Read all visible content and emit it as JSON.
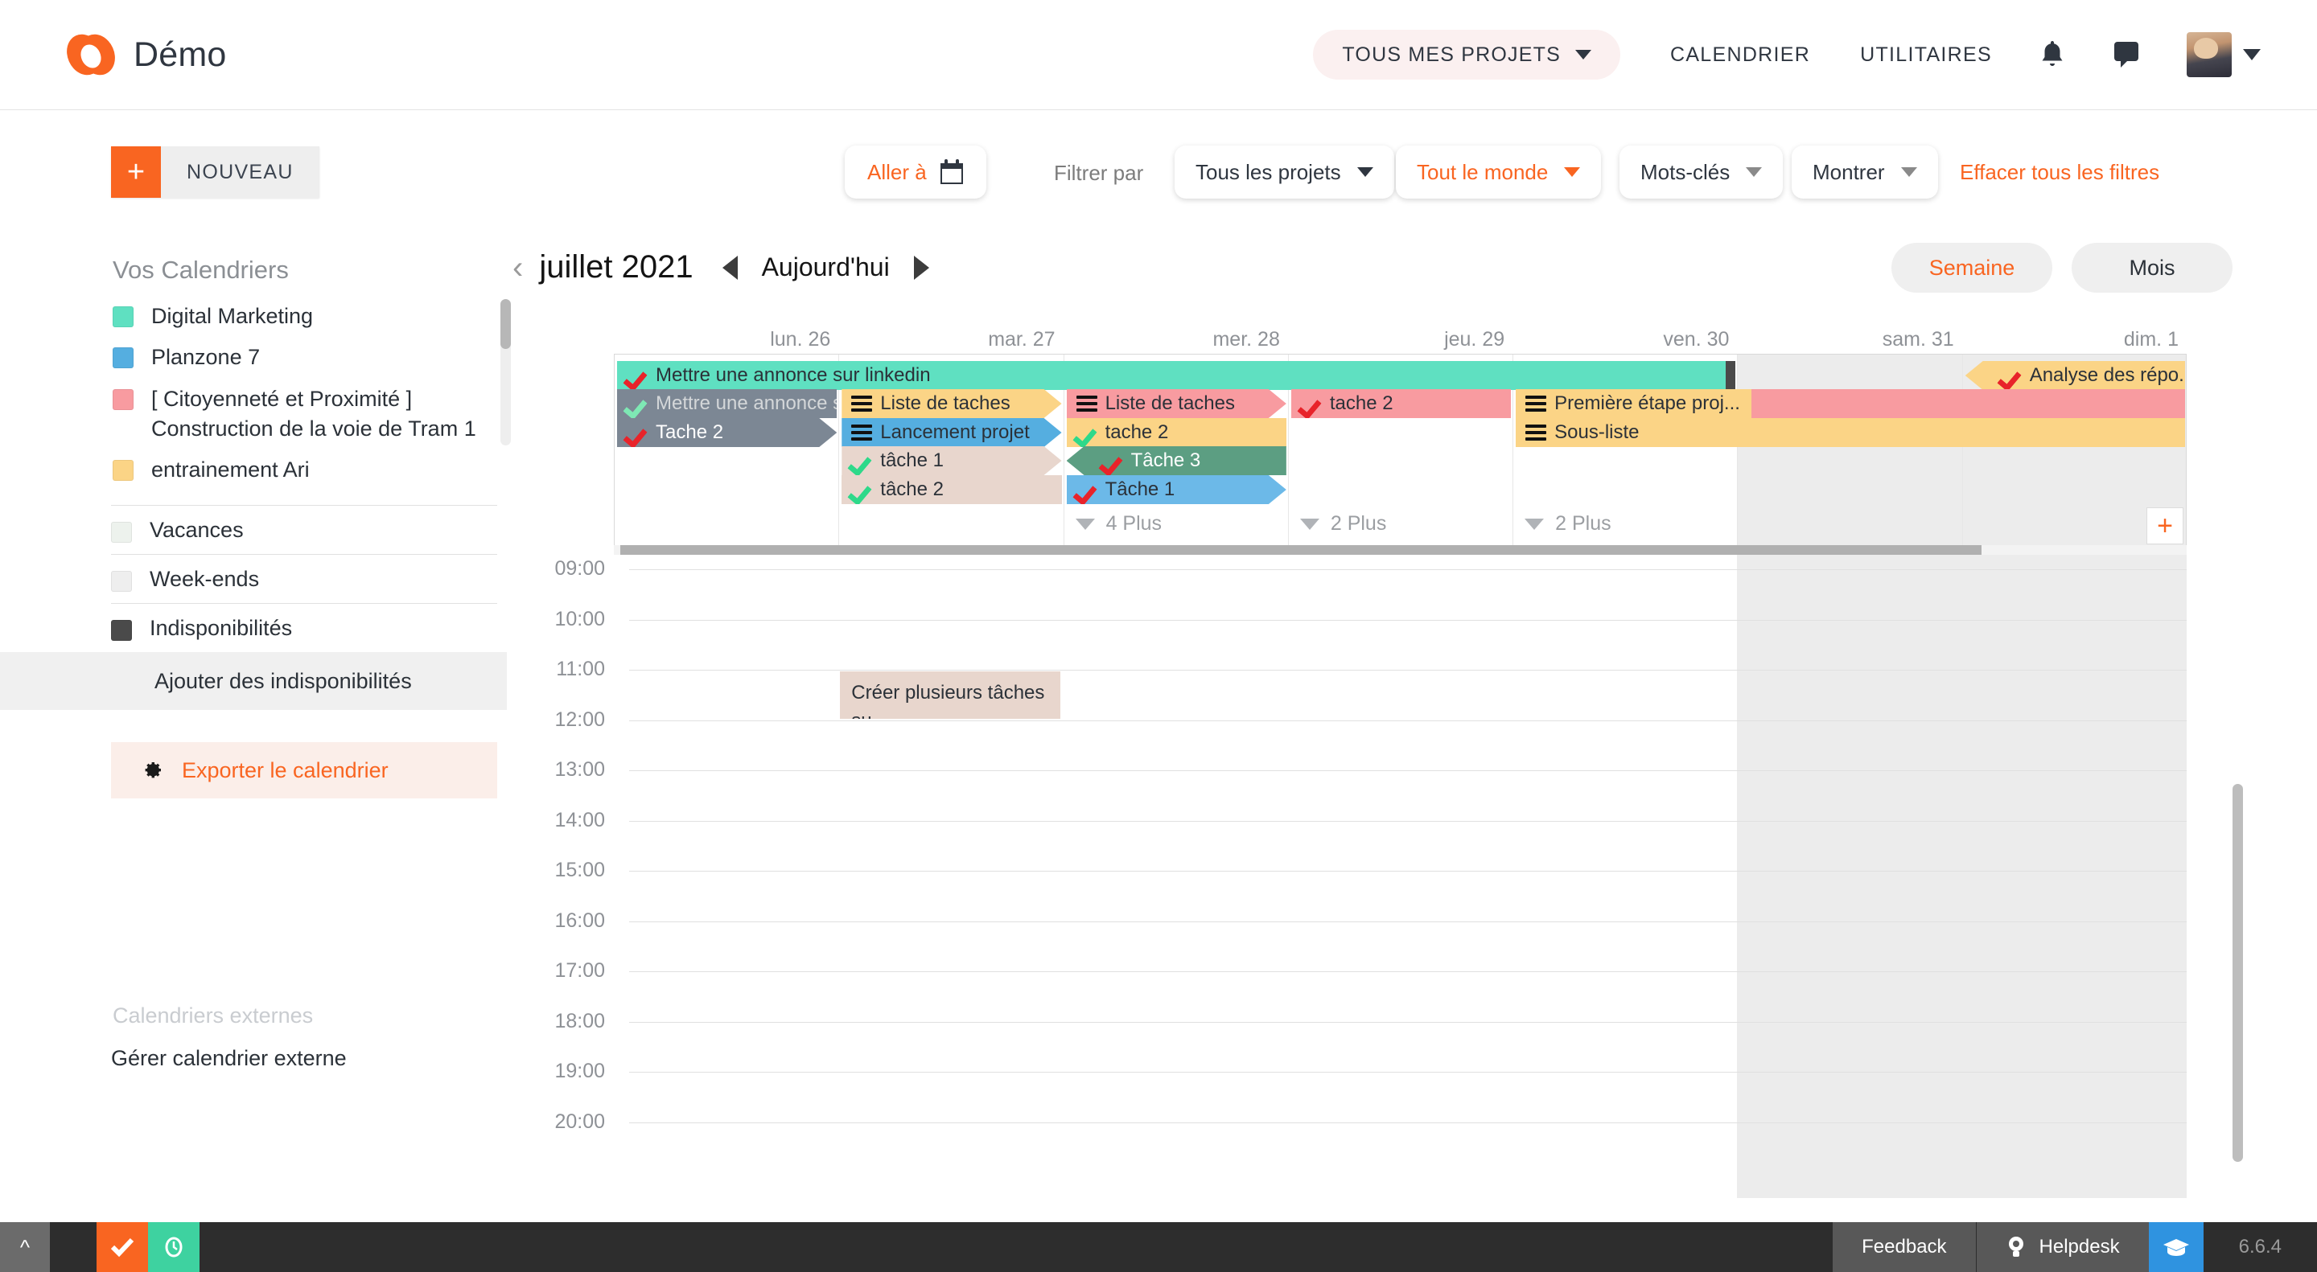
{
  "app": {
    "brand_name": "Démo",
    "logo_color": "#f96521"
  },
  "topnav": {
    "projects_selector": "TOUS MES PROJETS",
    "links": [
      "CALENDRIER",
      "UTILITAIRES"
    ],
    "bell_icon": "bell-icon",
    "chat_icon": "chat-bubble-icon",
    "avatar": "user-avatar"
  },
  "filterbar": {
    "new_button": "NOUVEAU",
    "new_plus": "+",
    "goto": "Aller à",
    "goto_icon": "calendar-icon",
    "filter_label": "Filtrer par",
    "dropdowns": [
      {
        "label": "Tous les projets",
        "accent": "#2f3640"
      },
      {
        "label": "Tout le monde",
        "accent": "#f96521"
      },
      {
        "label": "Mots-clés",
        "accent": "#2f3640"
      },
      {
        "label": "Montrer",
        "accent": "#2f3640"
      }
    ],
    "clear_filters": "Effacer tous les filtres"
  },
  "sidebar": {
    "title": "Vos Calendriers",
    "calendars": [
      {
        "name": "Digital Marketing",
        "color": "#5fe0c1"
      },
      {
        "name": "Planzone 7",
        "color": "#55aee0"
      },
      {
        "name": "[ Citoyenneté et Proximité ] Construction de la voie de Tram 1",
        "color": "#f89ba0"
      },
      {
        "name": "entrainement Ari",
        "color": "#fbd486"
      }
    ],
    "options": [
      {
        "name": "Vacances",
        "color": "#edf2ed"
      },
      {
        "name": "Week-ends",
        "color": "#eeeeee"
      },
      {
        "name": "Indisponibilités",
        "color": "#4a4a4a"
      }
    ],
    "add_indispo": "Ajouter des indisponibilités",
    "export": "Exporter le calendrier",
    "export_icon": "gear-icon",
    "external_title": "Calendriers externes",
    "external_link": "Gérer calendrier externe"
  },
  "calendar": {
    "prev_month_icon": "chevron-left-icon",
    "month": "juillet 2021",
    "prev_icon": "triangle-left-icon",
    "today": "Aujourd'hui",
    "next_icon": "triangle-right-icon",
    "views": [
      {
        "label": "Semaine",
        "active": true
      },
      {
        "label": "Mois",
        "active": false
      }
    ],
    "days": [
      {
        "label": "lun. 26",
        "weekend": false
      },
      {
        "label": "mar. 27",
        "weekend": false
      },
      {
        "label": "mer. 28",
        "weekend": false
      },
      {
        "label": "jeu. 29",
        "weekend": false
      },
      {
        "label": "ven. 30",
        "weekend": false
      },
      {
        "label": "sam. 31",
        "weekend": true
      },
      {
        "label": "dim. 1",
        "weekend": true
      }
    ],
    "allday_events": [
      {
        "title": "Mettre une annonce sur linkedin",
        "col": 0,
        "span": 5,
        "row": 0,
        "bg": "#5fe0c1",
        "icon": "check-red",
        "arrow": "none",
        "handle": true
      },
      {
        "title": "Analyse des répo...",
        "col": 6,
        "span": 1,
        "row": 0,
        "bg": "#fbd486",
        "icon": "check-red",
        "arrow": "left"
      },
      {
        "title": "Mettre une annonce s...",
        "col": 0,
        "span": 1,
        "row": 1,
        "bg": "#7c8794",
        "icon": "check-greenpale",
        "arrow": "none",
        "faded": true
      },
      {
        "title": "Liste de taches",
        "col": 1,
        "span": 1,
        "row": 1,
        "bg": "#fbd486",
        "icon": "hamburger",
        "arrow": "right"
      },
      {
        "title": "Liste de taches",
        "col": 2,
        "span": 1,
        "row": 1,
        "bg": "#f89ba0",
        "icon": "hamburger",
        "arrow": "right"
      },
      {
        "title": "tache 2",
        "col": 3,
        "span": 1,
        "row": 1,
        "bg": "#f89ba0",
        "icon": "check-red",
        "arrow": "none"
      },
      {
        "title": "Première étape proj...",
        "col": 4,
        "span": 3,
        "row": 1,
        "bg": "#f89ba0",
        "icon": "hamburger",
        "arrow": "none",
        "chip": "#fbd486"
      },
      {
        "title": "Tache 2",
        "col": 0,
        "span": 1,
        "row": 2,
        "bg": "#7c8794",
        "icon": "check-red",
        "arrow": "right",
        "white": true
      },
      {
        "title": "Lancement projet",
        "col": 1,
        "span": 1,
        "row": 2,
        "bg": "#55aee0",
        "icon": "hamburger",
        "arrow": "right"
      },
      {
        "title": "tache 2",
        "col": 2,
        "span": 1,
        "row": 2,
        "bg": "#fbd486",
        "icon": "check-green",
        "arrow": "none"
      },
      {
        "title": "Sous-liste",
        "col": 4,
        "span": 3,
        "row": 2,
        "bg": "#fbd486",
        "icon": "hamburger",
        "arrow": "none"
      },
      {
        "title": "tâche 1",
        "col": 1,
        "span": 1,
        "row": 3,
        "bg": "#e8d6cd",
        "icon": "check-green",
        "arrow": "right"
      },
      {
        "title": "Tâche 3",
        "col": 2,
        "span": 1,
        "row": 3,
        "bg": "#5c9e82",
        "icon": "check-red",
        "arrow": "left",
        "white": true
      },
      {
        "title": "tâche 2",
        "col": 1,
        "span": 1,
        "row": 4,
        "bg": "#e8d6cd",
        "icon": "check-green",
        "arrow": "none"
      },
      {
        "title": "Tâche 1",
        "col": 2,
        "span": 1,
        "row": 4,
        "bg": "#6cb9e8",
        "icon": "check-red",
        "arrow": "right"
      }
    ],
    "more_links": [
      {
        "label": "4 Plus",
        "col": 2
      },
      {
        "label": "2 Plus",
        "col": 3
      },
      {
        "label": "2 Plus",
        "col": 4
      }
    ],
    "add_event_button": "+",
    "hours": [
      "09:00",
      "10:00",
      "11:00",
      "12:00",
      "13:00",
      "14:00",
      "15:00",
      "16:00",
      "17:00",
      "18:00",
      "19:00",
      "20:00"
    ],
    "timed_events": [
      {
        "title": "Créer plusieurs tâches su...",
        "time": "11:00 - 12:00",
        "col": 1,
        "start_hour": "11:00",
        "end_hour": "12:00",
        "bg": "#e8d6cd"
      }
    ]
  },
  "statusbar": {
    "collapse_icon": "chevron-up-icon",
    "check_icon": "check-icon",
    "timer_icon": "clock-icon",
    "feedback": "Feedback",
    "helpdesk": "Helpdesk",
    "helpdesk_icon": "lightbulb-icon",
    "academy_icon": "graduation-cap-icon",
    "version": "6.6.4"
  }
}
